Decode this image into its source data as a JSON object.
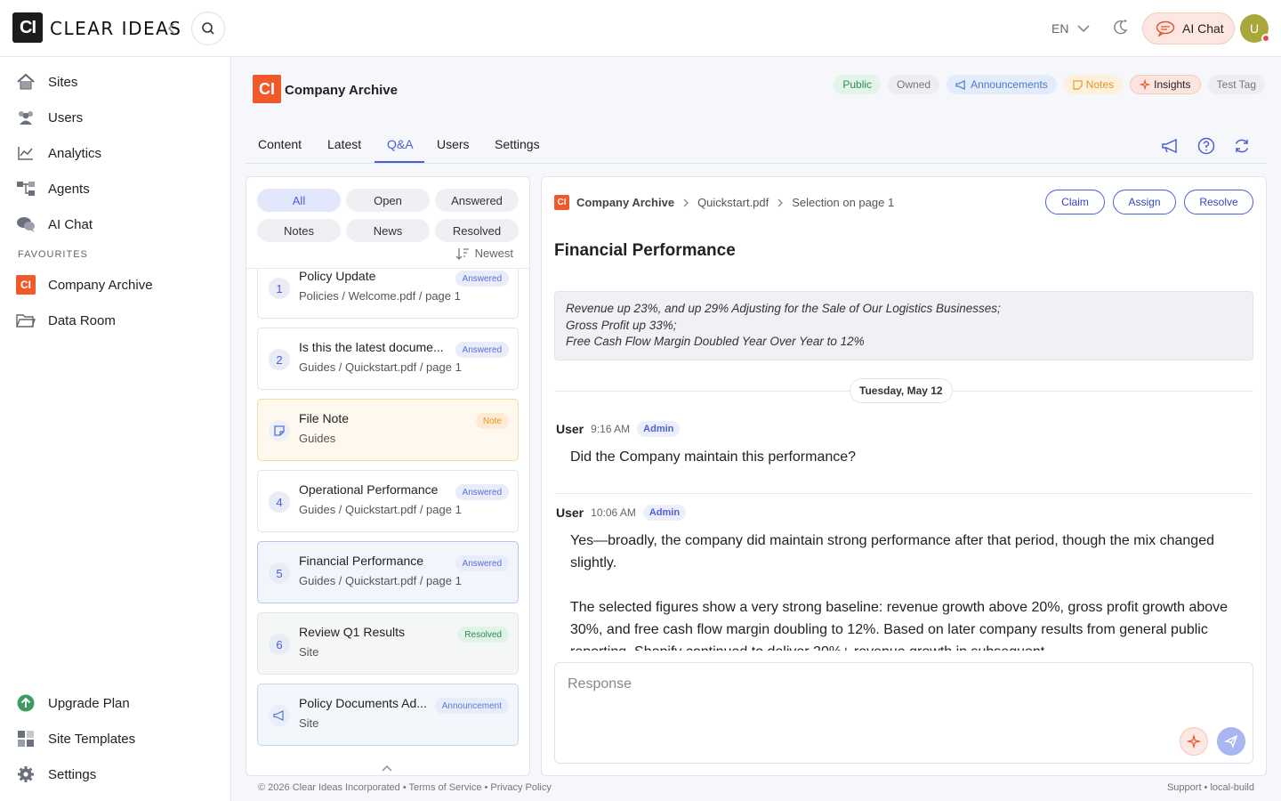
{
  "brand": {
    "mark": "CI",
    "name": "CLEAR IDEAS"
  },
  "header": {
    "language": "EN",
    "ai_chat_label": "AI Chat",
    "avatar_initial": "U"
  },
  "sidebar": {
    "items": [
      {
        "label": "Sites",
        "icon": "home-icon"
      },
      {
        "label": "Users",
        "icon": "users-icon"
      },
      {
        "label": "Analytics",
        "icon": "analytics-icon"
      },
      {
        "label": "Agents",
        "icon": "agents-icon"
      },
      {
        "label": "AI Chat",
        "icon": "chat-icon"
      }
    ],
    "favourites_heading": "FAVOURITES",
    "favourites": [
      {
        "label": "Company Archive",
        "icon": "company-logo-icon",
        "mark": "CI"
      },
      {
        "label": "Data Room",
        "icon": "folder-icon"
      }
    ],
    "bottom_items": [
      {
        "label": "Upgrade Plan",
        "icon": "upgrade-icon"
      },
      {
        "label": "Site Templates",
        "icon": "templates-icon"
      },
      {
        "label": "Settings",
        "icon": "gear-icon"
      }
    ]
  },
  "site": {
    "mark": "CI",
    "title": "Company Archive",
    "tags": [
      {
        "label": "Public",
        "bg": "#e3f4e8",
        "color": "#2e8a52"
      },
      {
        "label": "Owned",
        "bg": "#eceef2",
        "color": "#777777"
      },
      {
        "label": "Announcements",
        "bg": "#e4ecfb",
        "color": "#4a7bd0",
        "icon": "megaphone-icon"
      },
      {
        "label": "Notes",
        "bg": "#fdf0dc",
        "color": "#e6951c",
        "icon": "note-icon"
      },
      {
        "label": "Insights",
        "bg": "#fde5df",
        "color": "#222222",
        "icon": "sparkle-icon"
      },
      {
        "label": "Test Tag",
        "bg": "#eceef2",
        "color": "#777777"
      }
    ]
  },
  "tabs": [
    {
      "label": "Content",
      "active": false
    },
    {
      "label": "Latest",
      "active": false
    },
    {
      "label": "Q&A",
      "active": true
    },
    {
      "label": "Users",
      "active": false
    },
    {
      "label": "Settings",
      "active": false
    }
  ],
  "filters": {
    "row1": [
      "All",
      "Open",
      "Answered"
    ],
    "row2": [
      "Notes",
      "News",
      "Resolved"
    ],
    "active": "All",
    "sort_label": "Newest"
  },
  "questions": [
    {
      "num": "1",
      "title": "Policy Update",
      "sub": "Policies / Welcome.pdf / page 1",
      "badge": "Answered",
      "kind": "answered"
    },
    {
      "num": "2",
      "title": "Is this the latest docume...",
      "sub": "Guides / Quickstart.pdf / page 1",
      "badge": "Answered",
      "kind": "answered"
    },
    {
      "num": "",
      "title": "File Note",
      "sub": "Guides",
      "badge": "Note",
      "kind": "note"
    },
    {
      "num": "4",
      "title": "Operational Performance",
      "sub": "Guides / Quickstart.pdf / page 1",
      "badge": "Answered",
      "kind": "answered"
    },
    {
      "num": "5",
      "title": "Financial Performance",
      "sub": "Guides / Quickstart.pdf / page 1",
      "badge": "Answered",
      "kind": "selected"
    },
    {
      "num": "6",
      "title": "Review Q1 Results",
      "sub": "Site",
      "badge": "Resolved",
      "kind": "resolved"
    },
    {
      "num": "",
      "title": "Policy Documents Ad...",
      "sub": "Site",
      "badge": "Announcement",
      "kind": "announce"
    }
  ],
  "detail": {
    "breadcrumb": {
      "mark": "CI",
      "site": "Company Archive",
      "file": "Quickstart.pdf",
      "selection": "Selection on page 1"
    },
    "actions": [
      "Claim",
      "Assign",
      "Resolve"
    ],
    "title": "Financial Performance",
    "quote_lines": [
      "Revenue up 23%, and up 29% Adjusting for the Sale of Our Logistics Businesses;",
      "Gross Profit up 33%;",
      "Free Cash Flow Margin Doubled Year Over Year to 12%"
    ],
    "date": "Tuesday, May 12",
    "messages": [
      {
        "user": "User",
        "time": "9:16 AM",
        "role": "Admin",
        "body": "Did the Company maintain this performance?"
      },
      {
        "user": "User",
        "time": "10:06 AM",
        "role": "Admin",
        "paragraphs": [
          "Yes—broadly, the company did maintain strong performance after that period, though the mix changed slightly.",
          "The selected figures show a very strong baseline: revenue growth above 20%, gross profit growth above 30%, and free cash flow margin doubling to 12%. Based on later company results from general public reporting, Shopify continued to deliver 20%+ revenue growth in subsequent"
        ]
      }
    ],
    "response_placeholder": "Response"
  },
  "footer": {
    "left": "© 2026 Clear Ideas Incorporated • Terms of Service • Privacy Policy",
    "right": "Support • local-build"
  }
}
